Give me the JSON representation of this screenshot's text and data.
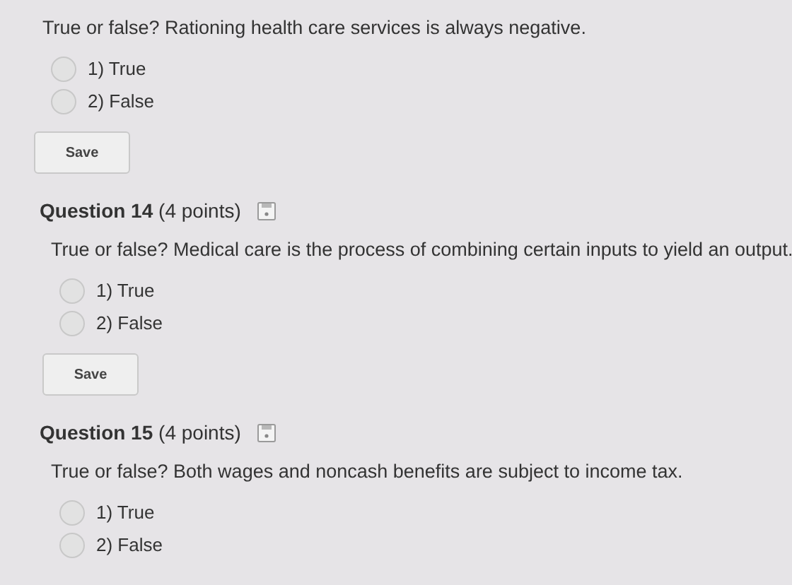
{
  "questions": [
    {
      "prompt": "True or false? Rationing health care services is always negative.",
      "options": [
        {
          "label": "1) True",
          "selected": false
        },
        {
          "label": "2) False",
          "selected": false
        }
      ],
      "button": "Save"
    },
    {
      "title": "Question 14",
      "points": "(4 points)",
      "prompt": "True or false? Medical care is the process of combining certain inputs to yield an output.",
      "options": [
        {
          "label": "1) True",
          "selected": false
        },
        {
          "label": "2) False",
          "selected": false
        }
      ],
      "button": "Save"
    },
    {
      "title": "Question 15",
      "points": "(4 points)",
      "prompt": "True or false? Both wages and noncash benefits are subject to income tax.",
      "options": [
        {
          "label": "1) True",
          "selected": false
        },
        {
          "label": "2) False",
          "selected": false
        }
      ]
    }
  ]
}
